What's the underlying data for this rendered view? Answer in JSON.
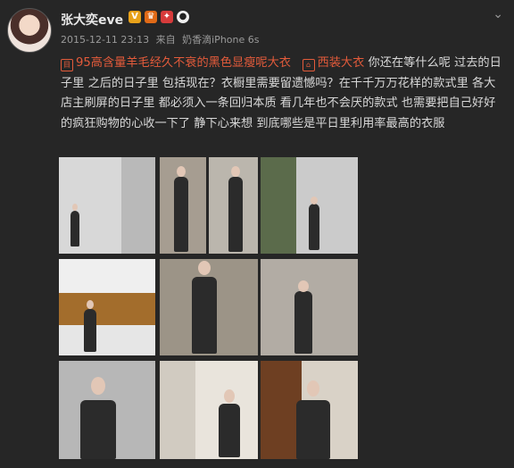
{
  "user": {
    "name": "张大奕eve",
    "badges": [
      "verified-v",
      "crown",
      "gift",
      "panda"
    ]
  },
  "post": {
    "timestamp": "2015-12-11 23:13",
    "source_prefix": "来自",
    "source": "奶香滴iPhone 6s",
    "links": [
      {
        "icon": "shop-icon",
        "text": "95高含量羊毛经久不衰的黑色显瘦呢大衣"
      },
      {
        "icon": "shop-icon",
        "text": "西装大衣"
      }
    ],
    "text_after_links": "你还在等什么呢 过去的日子里 之后的日子里 包括现在？衣橱里需要留遗憾吗？在千千万万花样的款式里 各大店主刷屏的日子里 都必须入一条回归本质 看几年也不会厌的款式 也需要把自己好好的疯狂购物的心收一下了 静下心来想 到底哪些是平日里利用率最高的衣服"
  },
  "more_icon": "chevron-down-icon",
  "images": [
    {
      "caption": ""
    },
    {
      "caption": ""
    },
    {
      "caption": ""
    },
    {
      "caption": ""
    },
    {
      "caption": ""
    },
    {
      "caption": ""
    },
    {
      "caption": ""
    },
    {
      "caption": ""
    },
    {
      "caption": ""
    },
    {
      "caption": ""
    }
  ]
}
